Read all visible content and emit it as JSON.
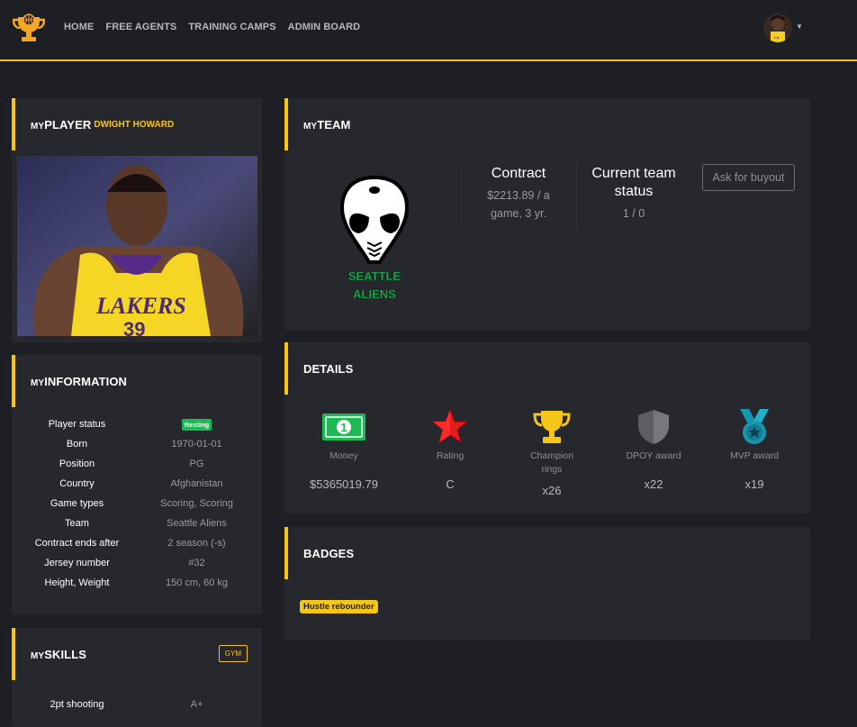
{
  "nav": {
    "links": [
      "HOME",
      "FREE AGENTS",
      "TRAINING CAMPS",
      "ADMIN BOARD"
    ],
    "brand_icon": "trophy-basketball-icon",
    "user_icon": "avatar"
  },
  "player_card": {
    "title_prefix": "MY",
    "title_main": "PLAYER",
    "player_name": "DWIGHT HOWARD"
  },
  "information_card": {
    "title_prefix": "MY",
    "title_main": "INFORMATION",
    "rows": [
      {
        "key": "Player status",
        "value": "Resting"
      },
      {
        "key": "Born",
        "value": "1970-01-01"
      },
      {
        "key": "Position",
        "value": "PG"
      },
      {
        "key": "Country",
        "value": "Afghanistan"
      },
      {
        "key": "Game types",
        "value": "Scoring, Scoring"
      },
      {
        "key": "Team",
        "value": "Seattle Aliens"
      },
      {
        "key": "Contract ends after",
        "value": "2 season (-s)"
      },
      {
        "key": "Jersey number",
        "value": "#32"
      },
      {
        "key": "Height, Weight",
        "value": "150 cm, 60 kg"
      }
    ]
  },
  "skills_card": {
    "title_prefix": "MY",
    "title_main": "SKILLS",
    "gym_label": "GYM",
    "rows": [
      {
        "key": "2pt shooting",
        "value": "A+"
      }
    ]
  },
  "team_card": {
    "title_prefix": "MY",
    "title_main": "TEAM",
    "logo_text_1": "SEATTLE",
    "logo_text_2": "ALIENS",
    "contract_heading": "Contract",
    "contract_value": "$2213.89 / a game, 3 yr.",
    "status_heading": "Current team status",
    "status_value": "1 / 0",
    "buyout_label": "Ask for buyout"
  },
  "details_card": {
    "title": "DETAILS",
    "items": [
      {
        "icon": "money-icon",
        "label": "Money",
        "value": "$5365019.79",
        "color": "#1db954"
      },
      {
        "icon": "star-icon",
        "label": "Rating",
        "value": "C",
        "color": "#e01e1e"
      },
      {
        "icon": "trophy-icon",
        "label": "Champion rings",
        "value": "x26",
        "color": "#f5c518"
      },
      {
        "icon": "shield-icon",
        "label": "DPOY award",
        "value": "x22",
        "color": "#6b6c72"
      },
      {
        "icon": "medal-icon",
        "label": "MVP award",
        "value": "x19",
        "color": "#1796b0"
      }
    ]
  },
  "badges_card": {
    "title": "BADGES",
    "badges": [
      "Hustle rebounder"
    ]
  },
  "colors": {
    "accent": "#f5c518",
    "background": "#1e1f24",
    "card": "#27282e",
    "status_green": "#1db954"
  }
}
